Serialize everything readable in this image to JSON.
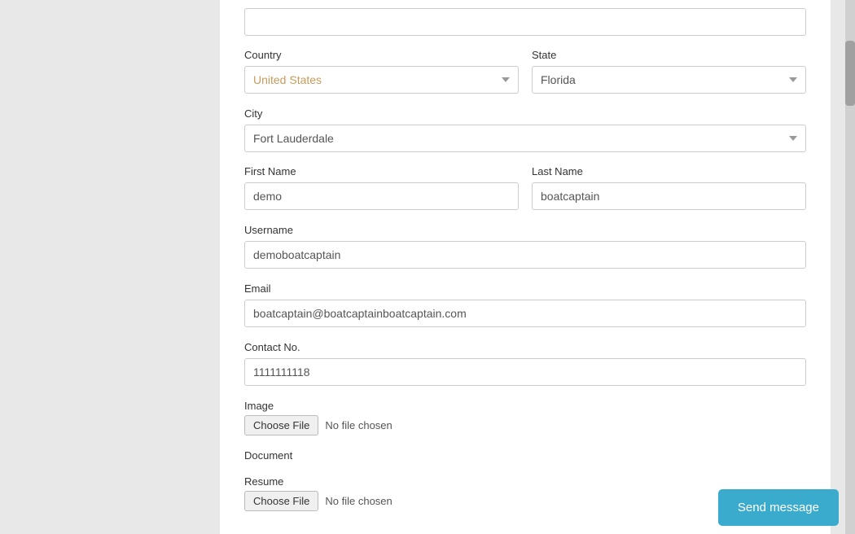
{
  "form": {
    "country_label": "Country",
    "state_label": "State",
    "city_label": "City",
    "first_name_label": "First Name",
    "last_name_label": "Last Name",
    "username_label": "Username",
    "email_label": "Email",
    "contact_label": "Contact No.",
    "image_label": "Image",
    "document_label": "Document",
    "resume_label": "Resume",
    "country_value": "United States",
    "state_value": "Florida",
    "city_value": "Fort Lauderdale",
    "first_name_value": "demo",
    "last_name_value": "boatcaptain",
    "username_value": "demoboatcaptain",
    "email_value": "boatcaptain@boatcaptainboatcaptain.com",
    "contact_value": "1111111118",
    "choose_file_label": "Choose File",
    "no_file_label": "No file chosen",
    "choose_file_label2": "Choose File",
    "no_file_label2": "No file chosen"
  },
  "buttons": {
    "send_message": "Send message"
  }
}
